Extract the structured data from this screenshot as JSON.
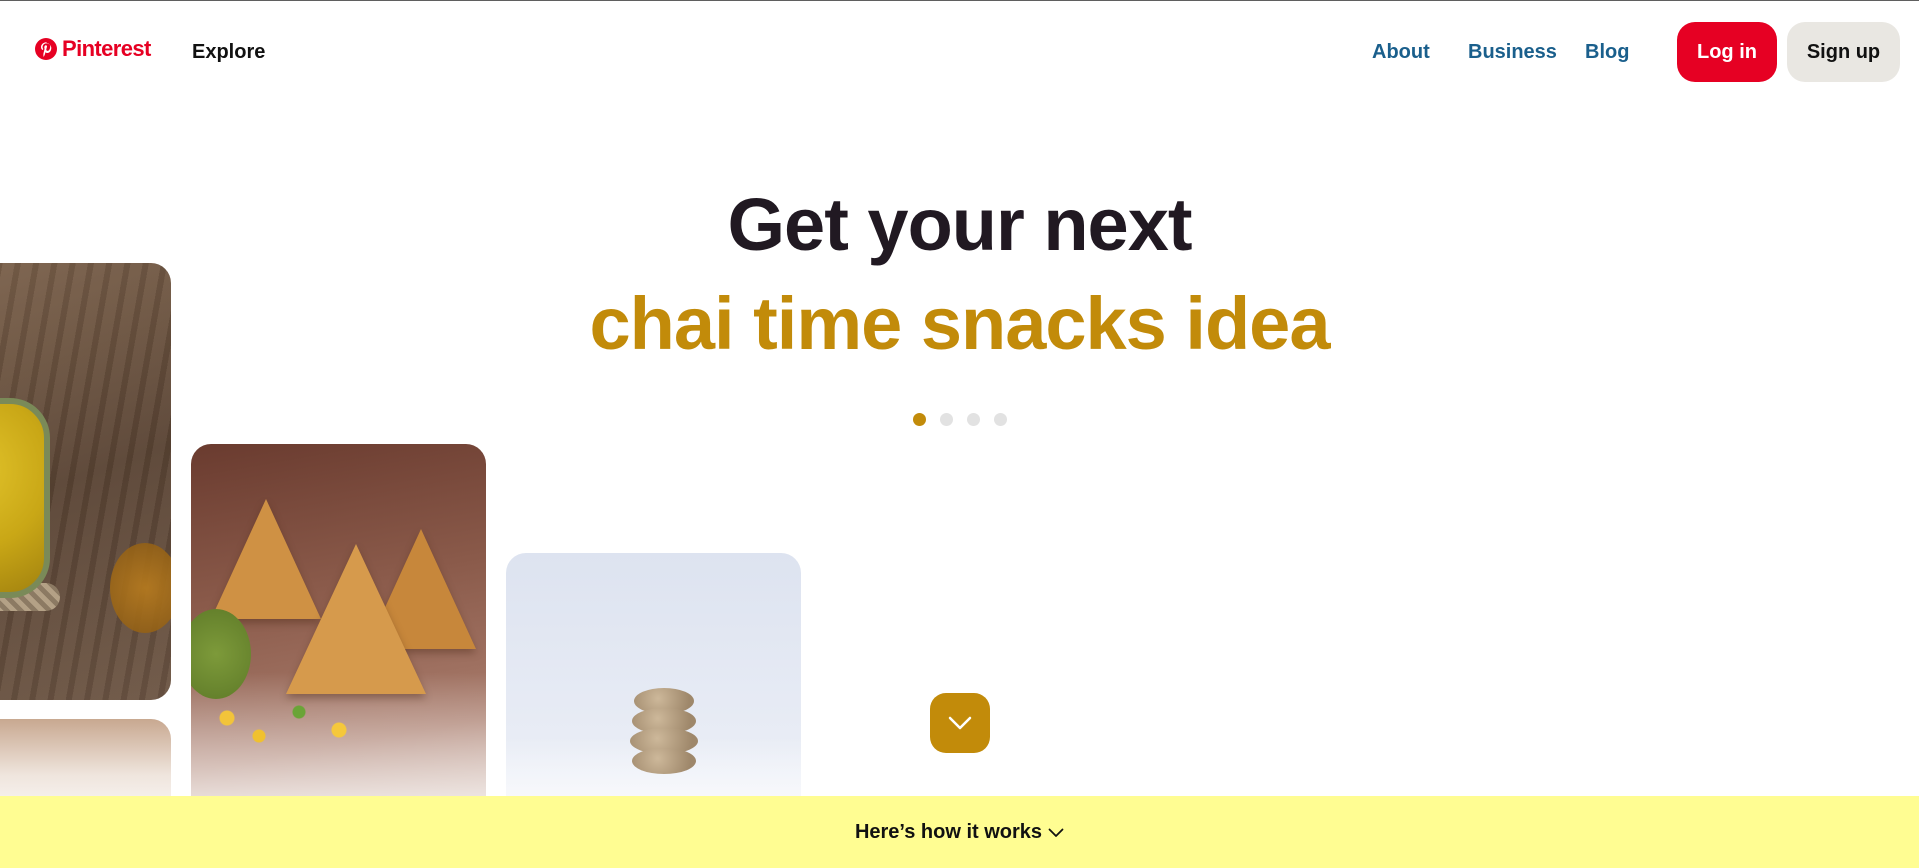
{
  "header": {
    "logo_text": "Pinterest",
    "explore_label": "Explore",
    "nav": {
      "about": "About",
      "business": "Business",
      "blog": "Blog"
    },
    "login_label": "Log in",
    "signup_label": "Sign up"
  },
  "hero": {
    "line1": "Get your next",
    "line2": "chai time snacks idea",
    "carousel_total": 4,
    "carousel_active_index": 0
  },
  "banner": {
    "label": "Here’s how it works",
    "icon": "chevron-down-icon"
  },
  "colors": {
    "brand_red": "#e60023",
    "accent_gold": "#c28b0a",
    "nav_link": "#1a5f8c",
    "banner_bg": "#fffd92",
    "signup_bg": "#e9e7e2"
  },
  "icons": {
    "logo": "pinterest-logo-icon",
    "scroll": "chevron-down-icon"
  }
}
